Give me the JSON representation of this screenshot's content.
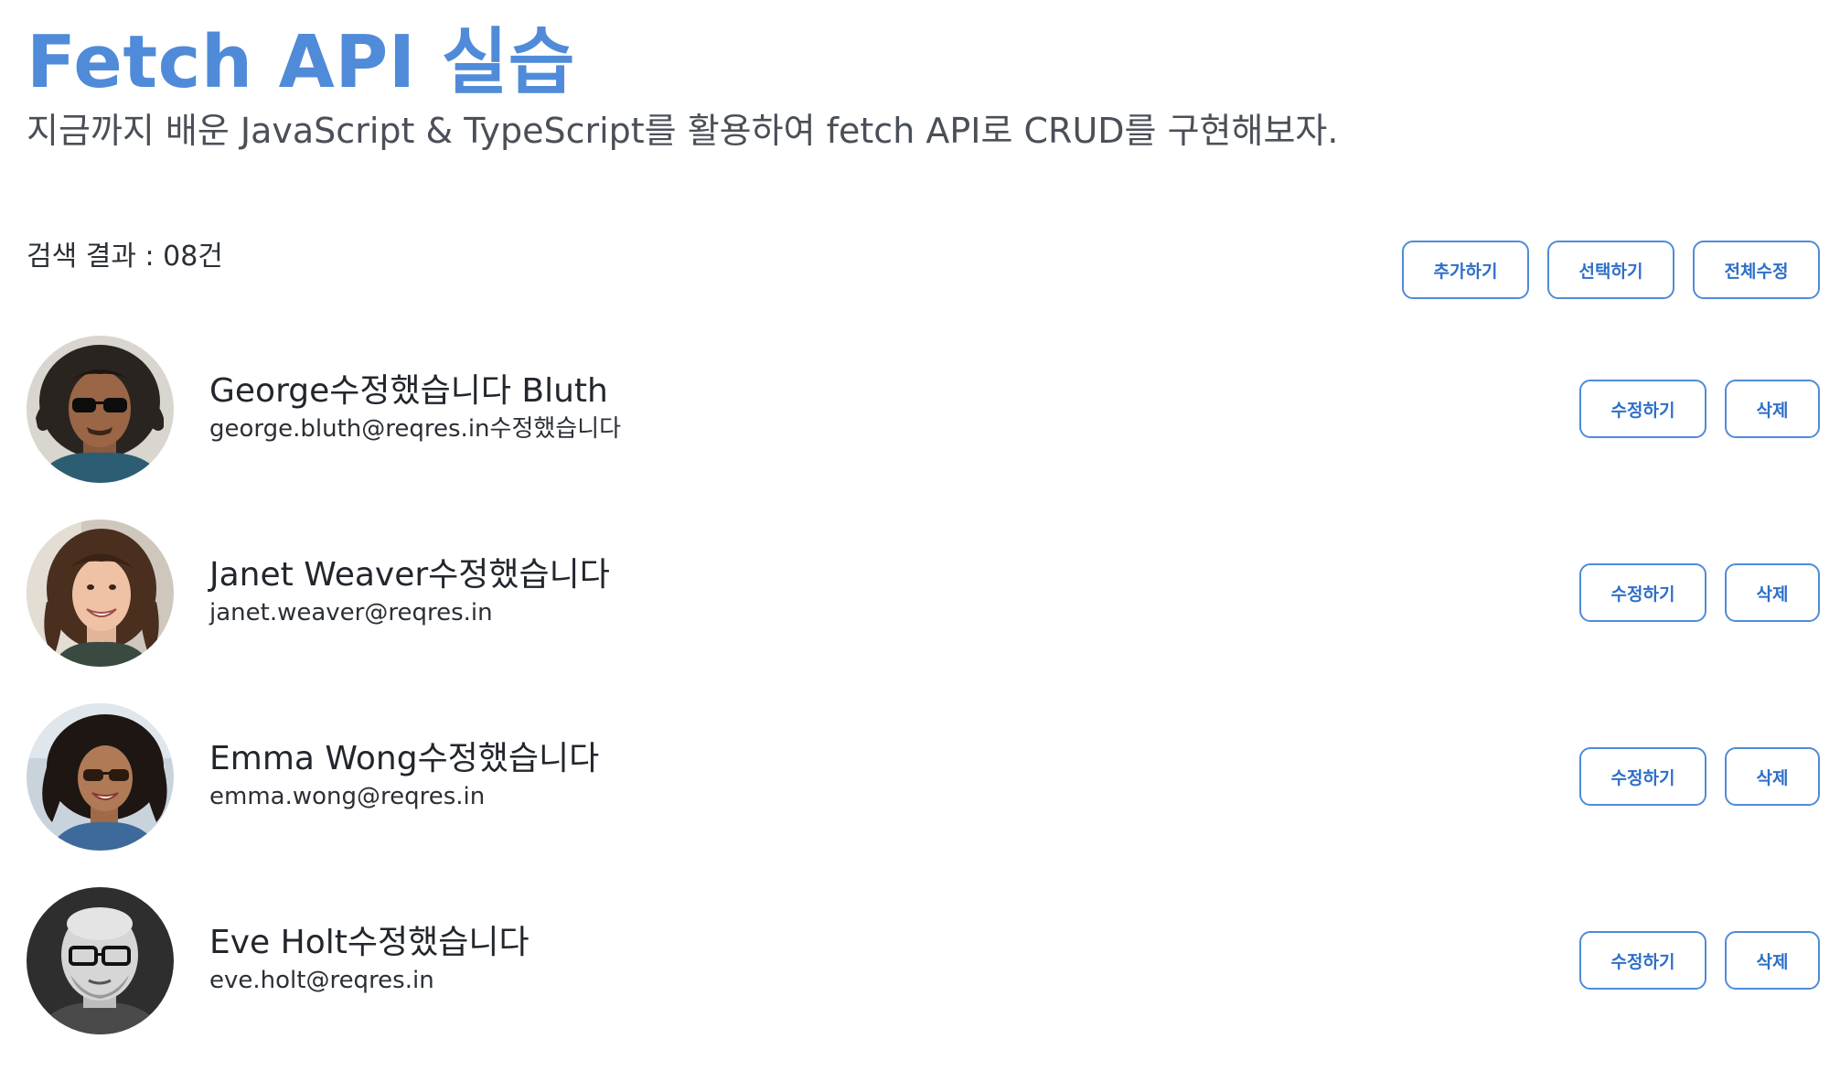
{
  "page": {
    "title": "Fetch API 실습",
    "subtitle": "지금까지 배운 JavaScript & TypeScript를 활용하여 fetch API로 CRUD를 구현해보자."
  },
  "toolbar": {
    "result_count": "검색 결과 : 08건",
    "add_label": "추가하기",
    "select_label": "선택하기",
    "edit_all_label": "전체수정"
  },
  "users": [
    {
      "name": "George수정했습니다 Bluth",
      "email": "george.bluth@reqres.in수정했습니다",
      "avatar": "avatar-george",
      "edit_label": "수정하기",
      "delete_label": "삭제"
    },
    {
      "name": "Janet Weaver수정했습니다",
      "email": "janet.weaver@reqres.in",
      "avatar": "avatar-janet",
      "edit_label": "수정하기",
      "delete_label": "삭제"
    },
    {
      "name": "Emma Wong수정했습니다",
      "email": "emma.wong@reqres.in",
      "avatar": "avatar-emma",
      "edit_label": "수정하기",
      "delete_label": "삭제"
    },
    {
      "name": "Eve Holt수정했습니다",
      "email": "eve.holt@reqres.in",
      "avatar": "avatar-eve",
      "edit_label": "수정하기",
      "delete_label": "삭제"
    }
  ],
  "colors": {
    "accent": "#4f8bd8",
    "button_text": "#2f6fc7",
    "text": "#2b2f36"
  }
}
